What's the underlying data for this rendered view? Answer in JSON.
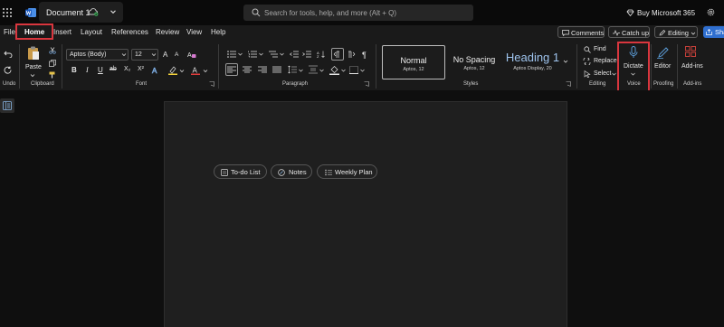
{
  "app": {
    "document_title": "Document 1",
    "search_placeholder": "Search for tools, help, and more (Alt + Q)",
    "buy_label": "Buy Microsoft 365"
  },
  "menu": {
    "tabs": [
      "File",
      "Home",
      "Insert",
      "Layout",
      "References",
      "Review",
      "View",
      "Help"
    ],
    "active_tab": "Home",
    "comments_label": "Comments",
    "catchup_label": "Catch up",
    "editing_label": "Editing",
    "share_label": "Share"
  },
  "ribbon": {
    "undo_label": "Undo",
    "clipboard": {
      "paste_label": "Paste",
      "group_label": "Clipboard"
    },
    "font": {
      "font_name": "Aptos (Body)",
      "font_size": "12",
      "group_label": "Font",
      "bold": "B",
      "italic": "I",
      "underline": "U",
      "strike": "ab",
      "subscript": "X₂",
      "superscript": "X²",
      "grow": "A",
      "shrink": "A"
    },
    "paragraph": {
      "group_label": "Paragraph",
      "pilcrow": "¶"
    },
    "styles": {
      "group_label": "Styles",
      "items": [
        {
          "name": "Normal",
          "sub": "Aptos, 12"
        },
        {
          "name": "No Spacing",
          "sub": "Aptos, 12"
        },
        {
          "name": "Heading 1",
          "sub": "Aptos Display, 20"
        }
      ]
    },
    "editing": {
      "find": "Find",
      "replace": "Replace",
      "select": "Select",
      "group_label": "Editing"
    },
    "voice": {
      "dictate": "Dictate",
      "group_label": "Voice"
    },
    "proofing": {
      "editor": "Editor",
      "group_label": "Proofing"
    },
    "addins": {
      "label": "Add-ins",
      "group_label": "Add-ins"
    }
  },
  "page": {
    "chips": [
      "To-do List",
      "Notes",
      "Weekly Plan"
    ]
  },
  "colors": {
    "highlight_box": "#d9363e",
    "accent_blue": "#5b9bd5",
    "share_blue": "#2f6fd0",
    "font_color_red": "#e03c3c",
    "highlighter_yellow": "#f2d13a"
  }
}
